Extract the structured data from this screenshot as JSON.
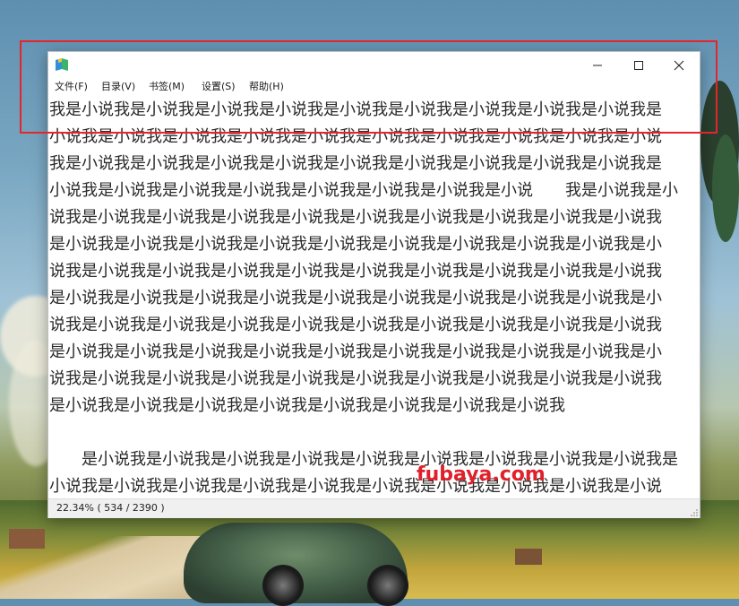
{
  "window": {
    "title_icon": "book-app-icon",
    "controls": {
      "minimize": "minimize-icon",
      "maximize": "maximize-icon",
      "close": "close-icon"
    }
  },
  "menu": {
    "items": [
      "文件(F)",
      "目录(V)",
      "书签(M)",
      "设置(S)",
      "帮助(H)"
    ]
  },
  "content": {
    "lines": [
      "我是小说我是小说我是小说我是小说我是小说我是小说我是小说我是小说我是小说我是",
      "小说我是小说我是小说我是小说我是小说我是小说我是小说我是小说我是小说我是小说",
      "我是小说我是小说我是小说我是小说我是小说我是小说我是小说我是小说我是小说我是",
      "小说我是小说我是小说我是小说我是小说我是小说我是小说我是小说　　我是小说我是小",
      "说我是小说我是小说我是小说我是小说我是小说我是小说我是小说我是小说我是小说我",
      "是小说我是小说我是小说我是小说我是小说我是小说我是小说我是小说我是小说我是小",
      "说我是小说我是小说我是小说我是小说我是小说我是小说我是小说我是小说我是小说我",
      "是小说我是小说我是小说我是小说我是小说我是小说我是小说我是小说我是小说我是小",
      "说我是小说我是小说我是小说我是小说我是小说我是小说我是小说我是小说我是小说我",
      "是小说我是小说我是小说我是小说我是小说我是小说我是小说我是小说我是小说我是小",
      "说我是小说我是小说我是小说我是小说我是小说我是小说我是小说我是小说我是小说我",
      "是小说我是小说我是小说我是小说我是小说我是小说我是小说我是小说我",
      "",
      "　　是小说我是小说我是小说我是小说我是小说我是小说我是小说我是小说我是小说我是",
      "小说我是小说我是小说我是小说我是小说我是小说我是小说我是小说我是小说我是小说"
    ],
    "watermark": "fubaya.com"
  },
  "status": {
    "text": "22.34%  ( 534 / 2390 )"
  },
  "colors": {
    "highlight": "#e3262b",
    "watermark": "#e0202b"
  }
}
